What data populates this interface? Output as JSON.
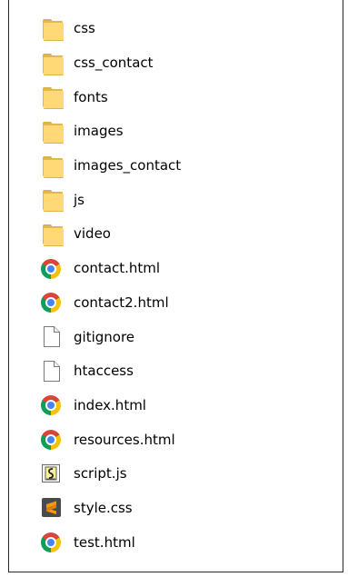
{
  "files": [
    {
      "name": "css",
      "type": "folder-icon"
    },
    {
      "name": "css_contact",
      "type": "folder-icon"
    },
    {
      "name": "fonts",
      "type": "folder-icon"
    },
    {
      "name": "images",
      "type": "folder-icon"
    },
    {
      "name": "images_contact",
      "type": "folder-icon"
    },
    {
      "name": "js",
      "type": "folder-icon"
    },
    {
      "name": "video",
      "type": "folder-icon"
    },
    {
      "name": "contact.html",
      "type": "chrome-icon"
    },
    {
      "name": "contact2.html",
      "type": "chrome-icon"
    },
    {
      "name": "gitignore",
      "type": "blank-file-icon"
    },
    {
      "name": "htaccess",
      "type": "blank-file-icon"
    },
    {
      "name": "index.html",
      "type": "chrome-icon"
    },
    {
      "name": "resources.html",
      "type": "chrome-icon"
    },
    {
      "name": "script.js",
      "type": "script-file-icon"
    },
    {
      "name": "style.css",
      "type": "sublime-text-icon"
    },
    {
      "name": "test.html",
      "type": "chrome-icon"
    }
  ],
  "colors": {
    "folder_front": "#ffd976",
    "folder_back": "#e2b84c",
    "chrome_red": "#db4437",
    "chrome_yellow": "#f4c20d",
    "chrome_green": "#0f9d58",
    "chrome_blue": "#4285f4",
    "sublime_orange": "#ff9800",
    "sublime_dark": "#4a4a4a"
  }
}
